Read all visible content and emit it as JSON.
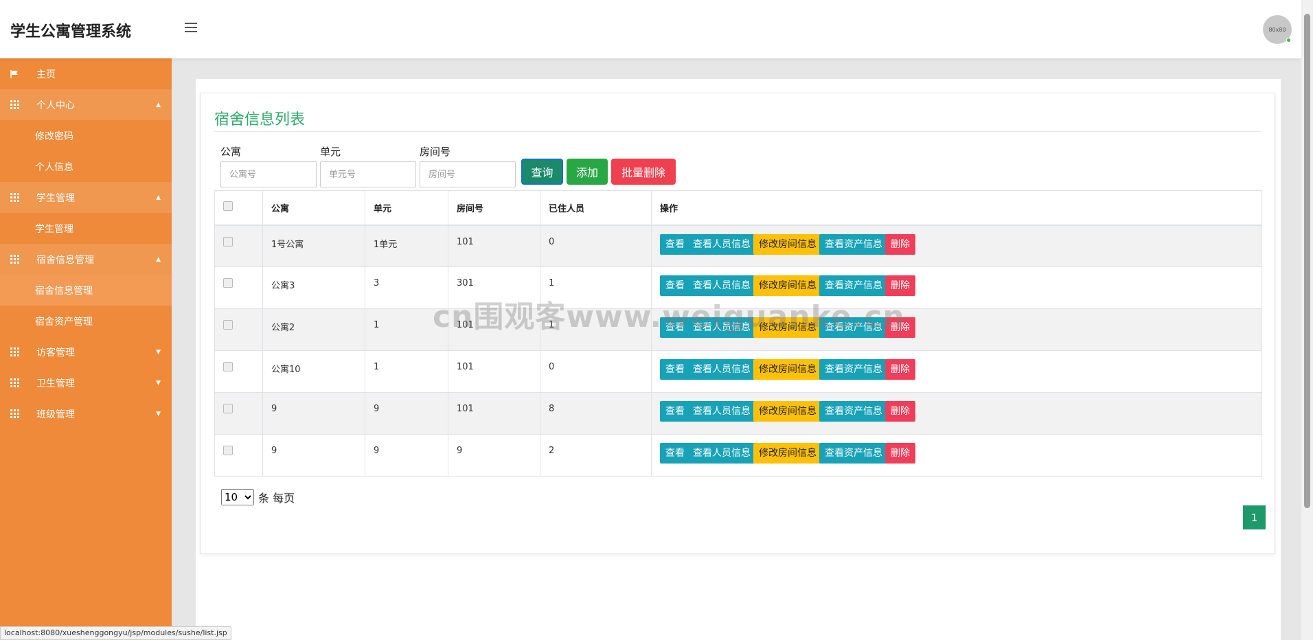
{
  "header": {
    "title": "学生公寓管理系统",
    "avatar_text": "80x80"
  },
  "sidebar": {
    "items": [
      {
        "label": "主页",
        "type": "top",
        "icon": "flag-icon"
      },
      {
        "label": "个人中心",
        "type": "parent",
        "icon": "grid-icon",
        "caret": "▲",
        "open": true
      },
      {
        "label": "修改密码",
        "type": "child"
      },
      {
        "label": "个人信息",
        "type": "child"
      },
      {
        "label": "学生管理",
        "type": "parent",
        "icon": "grid-icon",
        "caret": "▲",
        "open": true
      },
      {
        "label": "学生管理",
        "type": "child"
      },
      {
        "label": "宿舍信息管理",
        "type": "parent",
        "icon": "grid-icon",
        "caret": "▲",
        "open": true
      },
      {
        "label": "宿舍信息管理",
        "type": "child",
        "active": true
      },
      {
        "label": "宿舍资产管理",
        "type": "child"
      },
      {
        "label": "访客管理",
        "type": "parent",
        "icon": "grid-icon",
        "caret": "▼"
      },
      {
        "label": "卫生管理",
        "type": "parent",
        "icon": "grid-icon",
        "caret": "▼"
      },
      {
        "label": "班级管理",
        "type": "parent",
        "icon": "grid-icon",
        "caret": "▼"
      }
    ]
  },
  "main": {
    "title": "宿舍信息列表",
    "search": {
      "apartment": {
        "label": "公寓",
        "placeholder": "公寓号"
      },
      "unit": {
        "label": "单元",
        "placeholder": "单元号"
      },
      "room": {
        "label": "房间号",
        "placeholder": "房间号"
      }
    },
    "buttons": {
      "query": "查询",
      "add": "添加",
      "batch_delete": "批量删除"
    },
    "table": {
      "headers": [
        "公寓",
        "单元",
        "房间号",
        "已住人员",
        "操作"
      ],
      "rows": [
        {
          "apartment": "1号公寓",
          "unit": "1单元",
          "room": "101",
          "residents": "0"
        },
        {
          "apartment": "公寓3",
          "unit": "3",
          "room": "301",
          "residents": "1"
        },
        {
          "apartment": "公寓2",
          "unit": "1",
          "room": "101",
          "residents": "1"
        },
        {
          "apartment": "公寓10",
          "unit": "1",
          "room": "101",
          "residents": "0"
        },
        {
          "apartment": "9",
          "unit": "9",
          "room": "101",
          "residents": "8"
        },
        {
          "apartment": "9",
          "unit": "9",
          "room": "9",
          "residents": "2"
        }
      ],
      "ops": [
        "查看",
        "查看人员信息",
        "修改房间信息",
        "查看资产信息",
        "删除"
      ]
    },
    "pagination": {
      "page_size": "10",
      "page_size_suffix": "条 每页",
      "current_page": "1"
    }
  },
  "watermark": "cn围观客www.weiguanke.cn",
  "statusbar": "localhost:8080/xueshenggongyu/jsp/modules/sushe/list.jsp",
  "colors": {
    "sidebar": "#ef8a3a",
    "title": "#2eaa6a",
    "info": "#17a2b8",
    "warning": "#ffc107",
    "danger": "#f03e5a",
    "success": "#28a745"
  }
}
